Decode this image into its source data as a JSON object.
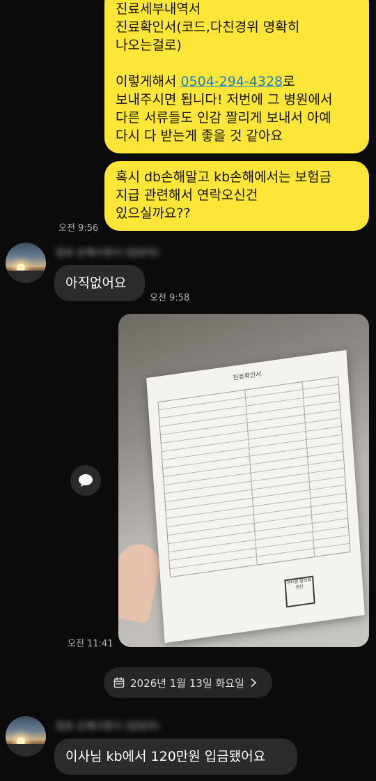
{
  "chat": {
    "msg1_lines": [
      "진료세부내역서",
      "진료확인서(코드,다친경위 명확히",
      "나오는걸로)"
    ],
    "msg1_blank": "",
    "msg1_send_prefix": "이렇게해서 ",
    "msg1_phone": "0504-294-4328",
    "msg1_send_suffix": "로",
    "msg1_lines2": [
      "보내주시면 됩니다! 저번에 그 병원에서",
      "다른 서류들도 인감 짤리게 보내서 아예",
      "다시 다 받는게 좋을 것 같아요"
    ],
    "msg2_lines": [
      "혹시 db손해말고 kb손해에서는 보험금",
      "지급 관련해서 연락오신건",
      "있으실까요??"
    ],
    "time_msg2": "오전 9:56",
    "sender_name": "임보 손해사정사 (담당자)",
    "reply1": "아직없어요",
    "time_reply1": "오전 9:58",
    "photo_doc_title": "진료확인서",
    "photo_stamp": "엔터원 발의료 원진",
    "time_photo": "오전 11:41",
    "date_separator": "2026년 1월 13일 화요일",
    "reply2": "이사님 kb에서 120만원 입금됐어요"
  },
  "icons": {
    "share": "share-speech-icon",
    "calendar": "calendar-icon",
    "chevron": "chevron-right-icon"
  },
  "colors": {
    "outgoing_bubble": "#fde637",
    "incoming_bubble": "#2b2b2b",
    "background": "#0b0b0b",
    "link": "#1d7fc4"
  }
}
